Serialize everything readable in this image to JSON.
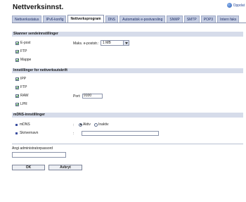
{
  "page": {
    "title": "Nettverksinnst.",
    "refresh_label": "Oppdat"
  },
  "tabs": [
    {
      "label": "Nettverksstatus",
      "active": false
    },
    {
      "label": "IPv6-konfig",
      "active": false
    },
    {
      "label": "Nettverksprogram",
      "active": true
    },
    {
      "label": "DNS",
      "active": false
    },
    {
      "label": "Automatisk e-postvarsling",
      "active": false
    },
    {
      "label": "SNMP",
      "active": false
    },
    {
      "label": "SMTP",
      "active": false
    },
    {
      "label": "POP3",
      "active": false
    },
    {
      "label": "Intern faks",
      "active": false
    }
  ],
  "scanner": {
    "heading": "Skanner sendeinnstillinger",
    "email_label": "E-post",
    "ftp_label": "FTP",
    "folder_label": "Mappe",
    "max_size_label": "Maks. e-poststr.:",
    "max_size_value": "1 MB"
  },
  "network_print": {
    "heading": "Innstillinger for nettverksutskrift",
    "ipp_label": "IPP",
    "ftp_label": "FTP",
    "raw_label": "RAW",
    "lpr_label": "LPR",
    "port_label": "Port:",
    "port_value": "9100"
  },
  "mdns": {
    "heading": "mDNS-innstillinger",
    "mdns_label": "mDNS",
    "active_label": "Aktiv",
    "inactive_label": "Inaktiv",
    "service_name_label": "Skrivernavn",
    "service_name_value": ""
  },
  "admin": {
    "password_label": "Angi administratorpassord",
    "password_value": ""
  },
  "buttons": {
    "ok": "OK",
    "cancel": "Avbryt"
  }
}
